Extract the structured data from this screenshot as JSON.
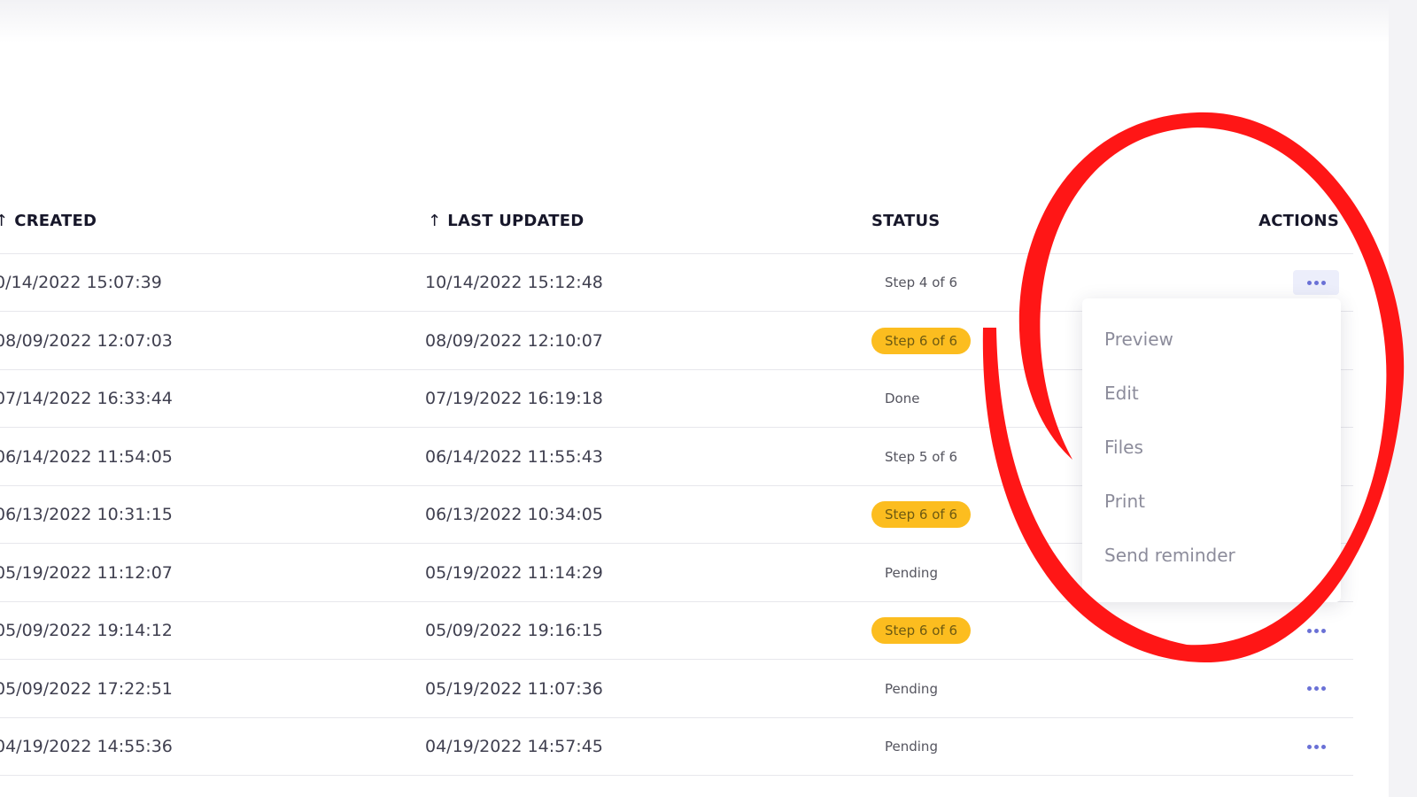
{
  "table": {
    "headers": {
      "created": "CREATED",
      "last_updated": "LAST UPDATED",
      "status": "STATUS",
      "actions": "ACTIONS"
    },
    "sort_arrow": "↑",
    "rows": [
      {
        "created": "0/14/2022 15:07:39",
        "updated": "10/14/2022 15:12:48",
        "status": "Step 4 of 6",
        "highlight": false
      },
      {
        "created": "08/09/2022 12:07:03",
        "updated": "08/09/2022 12:10:07",
        "status": "Step 6 of 6",
        "highlight": true
      },
      {
        "created": "07/14/2022 16:33:44",
        "updated": "07/19/2022 16:19:18",
        "status": "Done",
        "highlight": false
      },
      {
        "created": "06/14/2022 11:54:05",
        "updated": "06/14/2022 11:55:43",
        "status": "Step 5 of 6",
        "highlight": false
      },
      {
        "created": "06/13/2022 10:31:15",
        "updated": "06/13/2022 10:34:05",
        "status": "Step 6 of 6",
        "highlight": true
      },
      {
        "created": "05/19/2022 11:12:07",
        "updated": "05/19/2022 11:14:29",
        "status": "Pending",
        "highlight": false
      },
      {
        "created": "05/09/2022 19:14:12",
        "updated": "05/09/2022 19:16:15",
        "status": "Step 6 of 6",
        "highlight": true
      },
      {
        "created": "05/09/2022 17:22:51",
        "updated": "05/19/2022 11:07:36",
        "status": "Pending",
        "highlight": false
      },
      {
        "created": "04/19/2022 14:55:36",
        "updated": "04/19/2022 14:57:45",
        "status": "Pending",
        "highlight": false
      }
    ]
  },
  "actions_menu": {
    "items": [
      "Preview",
      "Edit",
      "Files",
      "Print",
      "Send reminder"
    ]
  },
  "icons": {
    "actions": "more-horizontal-icon"
  },
  "colors": {
    "status_highlight": "#fcbd1f",
    "action_dots": "#6a71d6",
    "annotation": "#ff1616"
  }
}
